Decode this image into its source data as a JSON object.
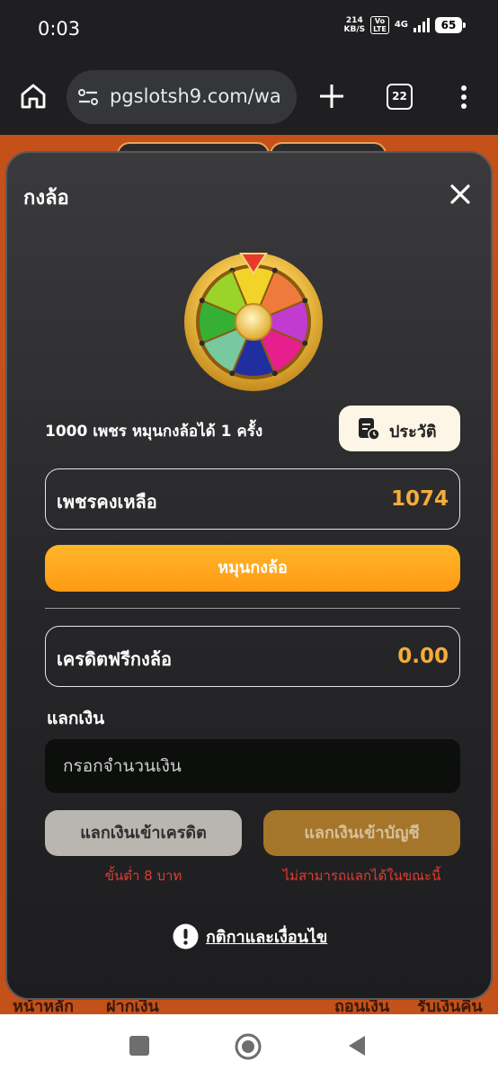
{
  "status_bar": {
    "time": "0:03",
    "net_speed_value": "214",
    "net_speed_unit": "KB/S",
    "volte_top": "Vo",
    "volte_bottom": "LTE",
    "network": "4G",
    "battery": "65"
  },
  "browser": {
    "url": "pgslotsh9.com/wa",
    "tab_count": "22"
  },
  "modal": {
    "title": "กงล้อ",
    "spin_info": "1000 เพชร หมุนกงล้อได้ 1 ครั้ง",
    "history_label": "ประวัติ",
    "diamonds_label": "เพชรคงเหลือ",
    "diamonds_value": "1074",
    "spin_button": "หมุนกงล้อ",
    "free_credit_label": "เครดิตฟรีกงล้อ",
    "free_credit_value": "0.00",
    "exchange_label": "แลกเงิน",
    "amount_placeholder": "กรอกจำนวนเงิน",
    "exchange_credit_button": "แลกเงินเข้าเครดิต",
    "exchange_account_button": "แลกเงินเข้าบัญชี",
    "credit_note": "ขั้นต่ำ 8 บาท",
    "account_note": "ไม่สามารถแลกได้ในขณะนี้",
    "terms_link": "กติกาและเงื่อนไข"
  },
  "bottom_nav_peek": {
    "home": "หน้าหลัก",
    "deposit": "ฝากเงิน",
    "withdraw": "ถอนเงิน",
    "cashback": "รับเงินคืน"
  },
  "colors": {
    "accent_orange": "#ff9a14",
    "value_gold": "#f3ad3a",
    "error_red": "#e23b2e",
    "page_orange": "#c4501a"
  },
  "wheel_segments": [
    "#f2d32a",
    "#f07a3c",
    "#c23ad0",
    "#e61f8c",
    "#1f2fa0",
    "#78c8a0",
    "#36b034",
    "#9ad32a"
  ]
}
